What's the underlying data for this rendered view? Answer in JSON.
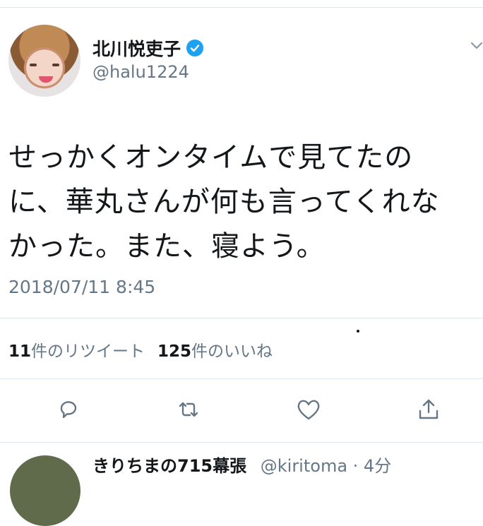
{
  "author": {
    "display_name": "北川悦吏子",
    "handle": "@halu1224",
    "verified": true
  },
  "tweet": {
    "lines": [
      "せっかくオンタイムで見てたの",
      "に、華丸さんが何も言ってくれな",
      "かった。また、寝よう。"
    ],
    "timestamp": "2018/07/11 8:45"
  },
  "stats": {
    "retweet_count": "11",
    "retweet_label": "件のリツイート",
    "like_count": "125",
    "like_label": "件のいいね"
  },
  "actions": {
    "reply_icon": "reply-icon",
    "retweet_icon": "retweet-icon",
    "like_icon": "heart-icon",
    "share_icon": "share-icon"
  },
  "next_reply": {
    "display_name": "きりちまの715幕張",
    "handle": "@kiritoma · 4分"
  },
  "colors": {
    "text": "#14171a",
    "secondary": "#657786",
    "verified": "#1da1f2",
    "divider": "#e1e8ed"
  }
}
